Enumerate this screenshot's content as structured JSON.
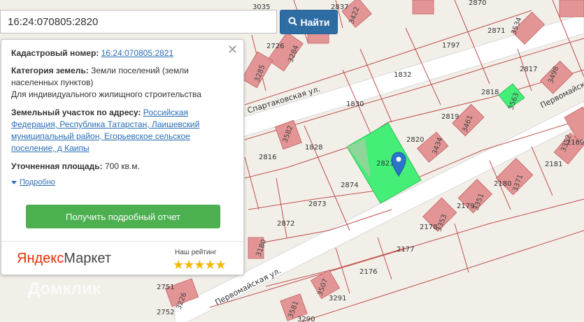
{
  "search": {
    "value": "16:24:070805:2820",
    "button_label": "Найти"
  },
  "panel": {
    "cadastral_label": "Кадастровый номер:",
    "cadastral_value": "16:24:070805:2821",
    "category_label": "Категория земель:",
    "category_value": "Земли поселений (земли населенных пунктов)",
    "usage": "Для индивидуального жилищного строительства",
    "address_label": "Земельный участок по адресу:",
    "address_value": "Российская Федерация, Республика Татарстан, Лаишевский муниципальный район, Егорьевское сельское поселение, д Каипы",
    "area_label": "Уточненная площадь:",
    "area_value": "700 кв.м.",
    "details_link": "Подробно",
    "report_button": "Получить подробный отчет",
    "partner_brand_1": "Яндекс",
    "partner_brand_2": "Маркет",
    "rating_label": "Наш рейтинг",
    "stars": "★★★★★"
  },
  "map": {
    "street_labels": [
      "Спартаковская ул.",
      "Первомайская ул.",
      "Первомайская ул."
    ],
    "parcel_numbers": [
      "1797",
      "1832",
      "1830",
      "1828",
      "2816",
      "2874",
      "2873",
      "2872",
      "2817",
      "2818",
      "2819",
      "2820",
      "2821",
      "2181",
      "2180",
      "2179",
      "2178",
      "2177",
      "2176",
      "2169",
      "2871",
      "2726",
      "3035",
      "2837",
      "2870",
      "3291",
      "3290",
      "2751",
      "2752"
    ],
    "building_numbers": [
      "3285",
      "3284",
      "3422",
      "3534",
      "3498",
      "3563",
      "3461",
      "3434",
      "3582",
      "3352",
      "3371",
      "3351",
      "3353",
      "3180",
      "3507",
      "3226",
      "3581"
    ],
    "highlight_color": "#44ee77",
    "watermark": "Домклик"
  }
}
